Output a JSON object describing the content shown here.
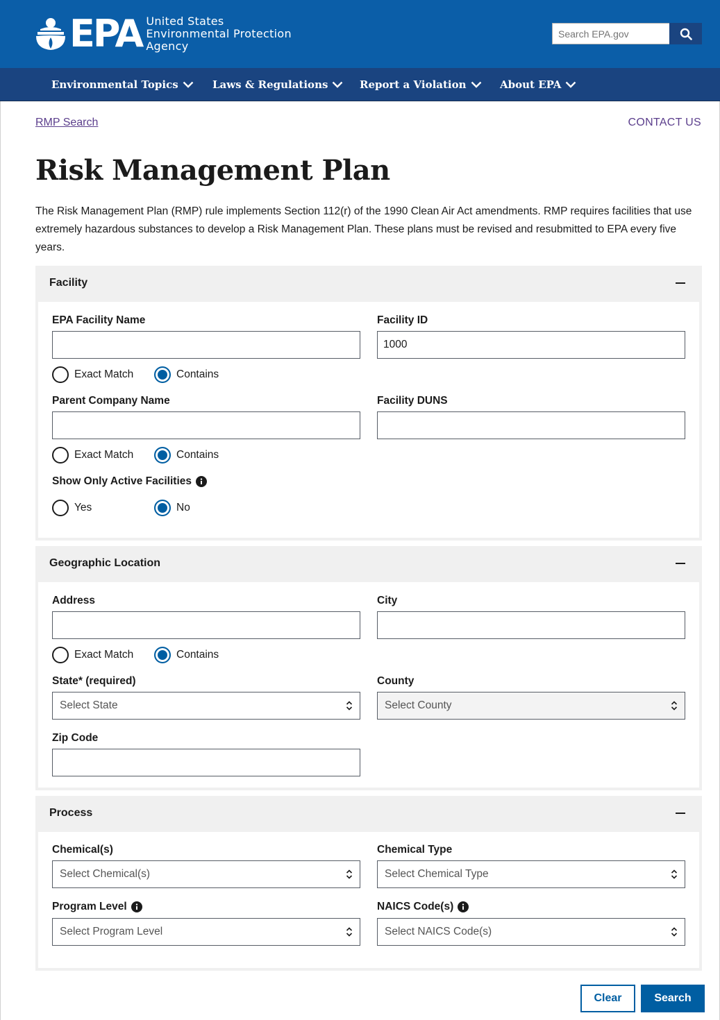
{
  "header": {
    "logo_text": "EPA",
    "agency_line1": "United States",
    "agency_line2": "Environmental Protection",
    "agency_line3": "Agency",
    "search_placeholder": "Search EPA.gov"
  },
  "nav": {
    "items": [
      {
        "label": "Environmental Topics"
      },
      {
        "label": "Laws & Regulations"
      },
      {
        "label": "Report a Violation"
      },
      {
        "label": "About EPA"
      }
    ]
  },
  "breadcrumb": "RMP Search",
  "contact": "CONTACT US",
  "page": {
    "title": "Risk Management Plan",
    "intro": "The Risk Management Plan (RMP) rule implements Section 112(r) of the 1990 Clean Air Act amendments. RMP requires facilities that use extremely hazardous substances to develop a Risk Management Plan. These plans must be revised and resubmitted to EPA every five years."
  },
  "facility": {
    "heading": "Facility",
    "name_label": "EPA Facility Name",
    "name_value": "",
    "id_label": "Facility ID",
    "id_value": "1000",
    "parent_label": "Parent Company Name",
    "parent_value": "",
    "duns_label": "Facility DUNS",
    "duns_value": "",
    "active_label": "Show Only Active Facilities",
    "exact_match": "Exact Match",
    "contains": "Contains",
    "yes": "Yes",
    "no": "No"
  },
  "geo": {
    "heading": "Geographic Location",
    "address_label": "Address",
    "city_label": "City",
    "state_label": "State* (required)",
    "state_placeholder": "Select State",
    "county_label": "County",
    "county_placeholder": "Select County",
    "zip_label": "Zip Code",
    "exact_match": "Exact Match",
    "contains": "Contains"
  },
  "process": {
    "heading": "Process",
    "chemicals_label": "Chemical(s)",
    "chemicals_placeholder": "Select Chemical(s)",
    "chemtype_label": "Chemical Type",
    "chemtype_placeholder": "Select Chemical Type",
    "program_label": "Program Level",
    "program_placeholder": "Select Program Level",
    "naics_label": "NAICS Code(s)",
    "naics_placeholder": "Select NAICS Code(s)"
  },
  "actions": {
    "clear": "Clear",
    "search": "Search"
  },
  "colors": {
    "header_blue": "#0b5ea8",
    "nav_blue": "#1a4480",
    "primary": "#005ea2",
    "link_visited": "#5b3e8c",
    "panel_gray": "#f0f0f0"
  },
  "icons": [
    "search-icon",
    "chevron-down-icon",
    "minus-icon",
    "info-icon",
    "sort-arrows-icon"
  ]
}
